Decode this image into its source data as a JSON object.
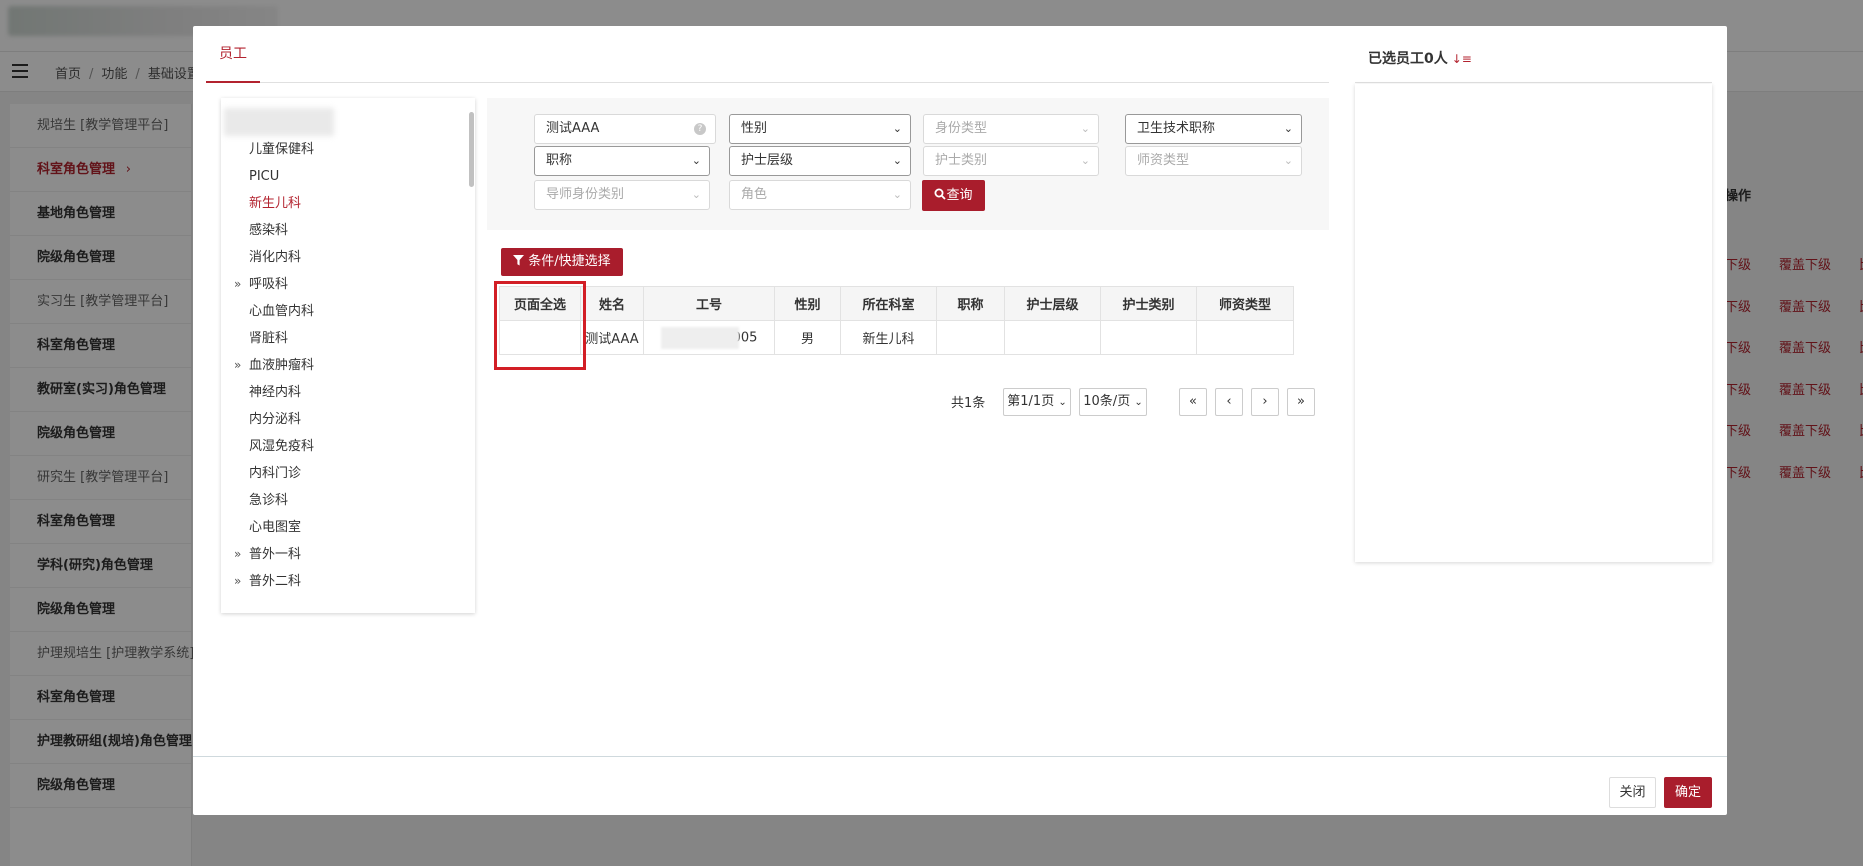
{
  "background": {
    "breadcrumb": [
      "首页",
      "功能",
      "基础设置"
    ],
    "sidebar": [
      {
        "label": "规培生 [教学管理平台]",
        "type": "group"
      },
      {
        "label": "科室角色管理",
        "type": "active"
      },
      {
        "label": "基地角色管理",
        "type": "item"
      },
      {
        "label": "院级角色管理",
        "type": "item"
      },
      {
        "label": "实习生 [教学管理平台]",
        "type": "group"
      },
      {
        "label": "科室角色管理",
        "type": "item"
      },
      {
        "label": "教研室(实习)角色管理",
        "type": "item"
      },
      {
        "label": "院级角色管理",
        "type": "item"
      },
      {
        "label": "研究生 [教学管理平台]",
        "type": "group"
      },
      {
        "label": "科室角色管理",
        "type": "item"
      },
      {
        "label": "学科(研究)角色管理",
        "type": "item"
      },
      {
        "label": "院级角色管理",
        "type": "item"
      },
      {
        "label": "护理规培生 [护理教学系统]",
        "type": "group"
      },
      {
        "label": "科室角色管理",
        "type": "item"
      },
      {
        "label": "护理教研组(规培)角色管理",
        "type": "item"
      },
      {
        "label": "院级角色管理",
        "type": "item"
      }
    ],
    "sidebar_arrow": "›",
    "right_header": "操作",
    "right_row_actions": [
      "下级",
      "覆盖下级",
      "比对"
    ]
  },
  "modal": {
    "tab_label": "员工",
    "tree_items": [
      {
        "label": "儿童保健科",
        "expandable": false,
        "active": false
      },
      {
        "label": "PICU",
        "expandable": false,
        "active": false
      },
      {
        "label": "新生儿科",
        "expandable": false,
        "active": true
      },
      {
        "label": "感染科",
        "expandable": false,
        "active": false
      },
      {
        "label": "消化内科",
        "expandable": false,
        "active": false
      },
      {
        "label": "呼吸科",
        "expandable": true,
        "active": false
      },
      {
        "label": "心血管内科",
        "expandable": false,
        "active": false
      },
      {
        "label": "肾脏科",
        "expandable": false,
        "active": false
      },
      {
        "label": "血液肿瘤科",
        "expandable": true,
        "active": false
      },
      {
        "label": "神经内科",
        "expandable": false,
        "active": false
      },
      {
        "label": "内分泌科",
        "expandable": false,
        "active": false
      },
      {
        "label": "风湿免疫科",
        "expandable": false,
        "active": false
      },
      {
        "label": "内科门诊",
        "expandable": false,
        "active": false
      },
      {
        "label": "急诊科",
        "expandable": false,
        "active": false
      },
      {
        "label": "心电图室",
        "expandable": false,
        "active": false
      },
      {
        "label": "普外一科",
        "expandable": true,
        "active": false
      },
      {
        "label": "普外二科",
        "expandable": true,
        "active": false
      }
    ],
    "filters": {
      "search_value": "测试AAA",
      "gender": "性别",
      "identity_type": "身份类型",
      "health_title": "卫生技术职称",
      "job_title": "职称",
      "nurse_level": "护士层级",
      "nurse_category": "护士类别",
      "teacher_type": "师资类型",
      "mentor_identity": "导师身份类别",
      "role": "角色",
      "query_button": "查询"
    },
    "condition_button": "条件/快捷选择",
    "table": {
      "headers": [
        "页面全选",
        "姓名",
        "工号",
        "性别",
        "所在科室",
        "职称",
        "护士层级",
        "护士类别",
        "师资类型"
      ],
      "rows": [
        {
          "name": "测试AAA",
          "id_suffix": "005",
          "gender": "男",
          "dept": "新生儿科",
          "title": "",
          "nurse_level": "",
          "nurse_category": "",
          "teacher_type": ""
        }
      ]
    },
    "pagination": {
      "total": "共1条",
      "page": "第1/1页",
      "page_size": "10条/页",
      "first": "«",
      "prev": "‹",
      "next": "›",
      "last": "»"
    },
    "selected_panel_title": "已选员工0人",
    "footer": {
      "close_label": "关闭",
      "ok_label": "确定"
    }
  },
  "colors": {
    "accent": "#a91d2c",
    "highlight_box": "#d21e25"
  }
}
